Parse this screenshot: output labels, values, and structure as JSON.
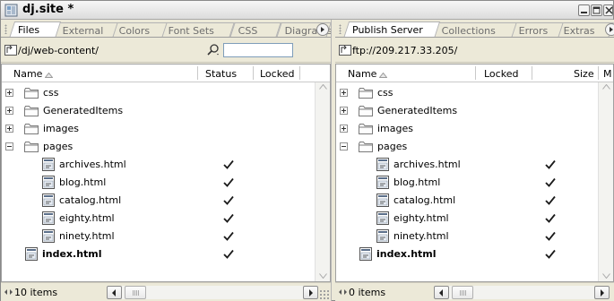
{
  "window": {
    "title": "dj.site *"
  },
  "left_panel": {
    "tabs": [
      {
        "label": "Files",
        "active": true
      },
      {
        "label": "External",
        "active": false
      },
      {
        "label": "Colors",
        "active": false
      },
      {
        "label": "Font Sets",
        "active": false
      },
      {
        "label": "CSS",
        "active": false
      },
      {
        "label": "Diagrams",
        "active": false
      }
    ],
    "path": "/dj/web-content/",
    "search": {
      "value": "",
      "placeholder": ""
    },
    "columns": {
      "name": "Name",
      "status": "Status",
      "locked": "Locked"
    },
    "items": [
      {
        "type": "folder",
        "name": "css",
        "expanded": false,
        "check": false
      },
      {
        "type": "folder",
        "name": "GeneratedItems",
        "expanded": false,
        "check": false
      },
      {
        "type": "folder",
        "name": "images",
        "expanded": false,
        "check": false
      },
      {
        "type": "folder",
        "name": "pages",
        "expanded": true,
        "check": false
      },
      {
        "type": "file",
        "name": "archives.html",
        "indent": 1,
        "check": true
      },
      {
        "type": "file",
        "name": "blog.html",
        "indent": 1,
        "check": true
      },
      {
        "type": "file",
        "name": "catalog.html",
        "indent": 1,
        "check": true
      },
      {
        "type": "file",
        "name": "eighty.html",
        "indent": 1,
        "check": true
      },
      {
        "type": "file",
        "name": "ninety.html",
        "indent": 1,
        "check": true
      },
      {
        "type": "file",
        "name": "index.html",
        "indent": 0,
        "bold": true,
        "check": true
      }
    ],
    "status_text": "10 items"
  },
  "right_panel": {
    "tabs": [
      {
        "label": "Publish Server",
        "active": true
      },
      {
        "label": "Collections",
        "active": false
      },
      {
        "label": "Errors",
        "active": false
      },
      {
        "label": "Extras",
        "active": false
      }
    ],
    "path": "ftp://209.217.33.205/",
    "columns": {
      "name": "Name",
      "locked": "Locked",
      "size": "Size",
      "modified": "M"
    },
    "items": [
      {
        "type": "folder",
        "name": "css",
        "expanded": false,
        "check": false
      },
      {
        "type": "folder",
        "name": "GeneratedItems",
        "expanded": false,
        "check": false
      },
      {
        "type": "folder",
        "name": "images",
        "expanded": false,
        "check": false
      },
      {
        "type": "folder",
        "name": "pages",
        "expanded": true,
        "check": false
      },
      {
        "type": "file",
        "name": "archives.html",
        "indent": 1,
        "check": true
      },
      {
        "type": "file",
        "name": "blog.html",
        "indent": 1,
        "check": true
      },
      {
        "type": "file",
        "name": "catalog.html",
        "indent": 1,
        "check": true
      },
      {
        "type": "file",
        "name": "eighty.html",
        "indent": 1,
        "check": true
      },
      {
        "type": "file",
        "name": "ninety.html",
        "indent": 1,
        "check": true
      },
      {
        "type": "file",
        "name": "index.html",
        "indent": 0,
        "bold": true,
        "check": true
      }
    ],
    "status_text": "0 items"
  },
  "colors": {
    "folder_outline": "#7a7a7a",
    "checkmark": "#1a1a1a",
    "file_icon_accent": "#5b6f8a"
  }
}
